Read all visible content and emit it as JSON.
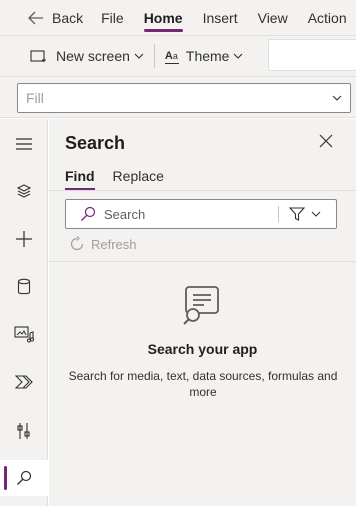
{
  "menubar": {
    "back_label": "Back",
    "items": [
      {
        "label": "File",
        "active": false
      },
      {
        "label": "Home",
        "active": true
      },
      {
        "label": "Insert",
        "active": false
      },
      {
        "label": "View",
        "active": false
      },
      {
        "label": "Action",
        "active": false
      }
    ]
  },
  "toolbar": {
    "new_screen_label": "New screen",
    "theme_label": "Theme"
  },
  "property": {
    "selected": "Fill"
  },
  "rail": {
    "items": [
      {
        "icon": "hamburger-icon"
      },
      {
        "icon": "layers-icon"
      },
      {
        "icon": "plus-icon"
      },
      {
        "icon": "database-icon"
      },
      {
        "icon": "media-icon"
      },
      {
        "icon": "power-automate-icon"
      },
      {
        "icon": "tools-icon"
      },
      {
        "icon": "search-icon",
        "active": true
      }
    ]
  },
  "pane": {
    "title": "Search",
    "tabs": [
      {
        "label": "Find",
        "active": true
      },
      {
        "label": "Replace",
        "active": false
      }
    ],
    "search_placeholder": "Search",
    "refresh_label": "Refresh",
    "empty_title": "Search your app",
    "empty_desc": "Search for media, text, data sources, formulas and more"
  },
  "colors": {
    "accent": "#742774",
    "chrome": "#f3f2f1"
  }
}
